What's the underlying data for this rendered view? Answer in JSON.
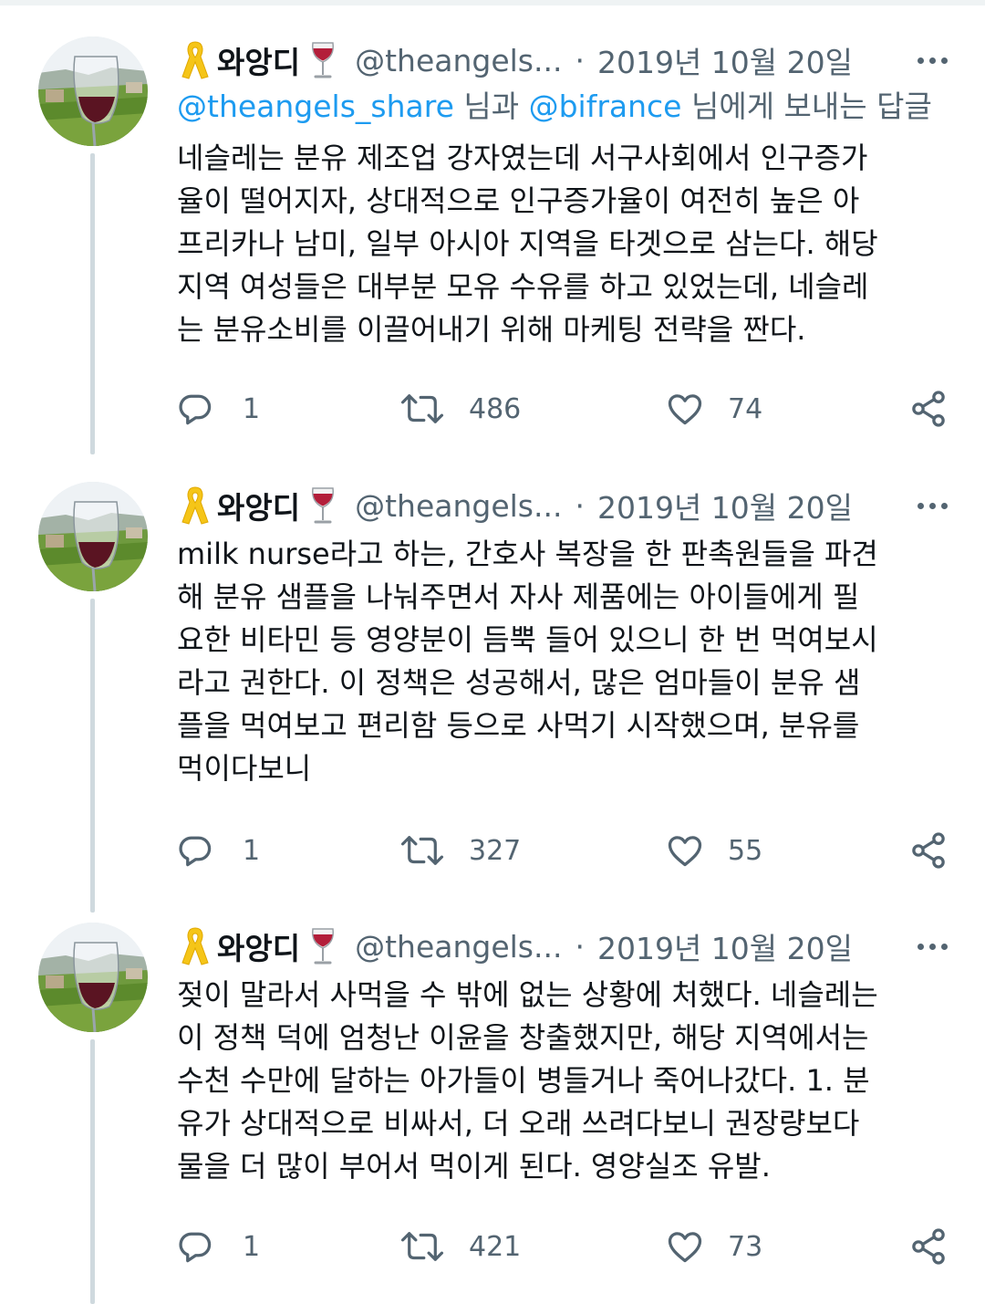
{
  "colors": {
    "text": "#0f1419",
    "secondary": "#536471",
    "link": "#1d9bf0",
    "thread_line": "#cfd9de"
  },
  "author": {
    "display_name": "와앙디",
    "handle": "@theangels...",
    "avatar_icon": "wine-glass-vineyard-avatar",
    "name_icons": [
      "yellow-ribbon-icon",
      "wine-glass-icon"
    ]
  },
  "tweets": [
    {
      "date": "2019년 10월 20일",
      "reply_to": {
        "mention1": "@theangels_share",
        "mid": " 님과 ",
        "mention2": "@bifrance",
        "end": " 님에게 보내는 답글"
      },
      "lines": [
        "네슬레는 분유 제조업 강자였는데 서구사회에서 인구증가",
        "율이 떨어지자, 상대적으로 인구증가율이 여전히 높은 아",
        "프리카나 남미, 일부 아시아 지역을 타겟으로 삼는다. 해당",
        "지역 여성들은 대부분 모유 수유를 하고 있었는데, 네슬레",
        "는 분유소비를 이끌어내기 위해 마케팅 전략을 짠다."
      ],
      "replies": "1",
      "retweets": "486",
      "likes": "74"
    },
    {
      "date": "2019년 10월 20일",
      "lines": [
        "milk nurse라고 하는, 간호사 복장을 한 판촉원들을 파견",
        "해 분유 샘플을 나눠주면서 자사 제품에는 아이들에게 필",
        "요한 비타민 등 영양분이 듬뿍 들어 있으니 한 번 먹여보시",
        "라고 권한다. 이 정책은 성공해서, 많은 엄마들이 분유 샘",
        "플을 먹여보고 편리함 등으로 사먹기 시작했으며, 분유를",
        "먹이다보니"
      ],
      "replies": "1",
      "retweets": "327",
      "likes": "55"
    },
    {
      "date": "2019년 10월 20일",
      "lines": [
        "젖이 말라서 사먹을 수 밖에 없는 상황에 처했다. 네슬레는",
        "이 정책 덕에 엄청난 이윤을 창출했지만, 해당 지역에서는",
        "수천 수만에 달하는 아가들이 병들거나 죽어나갔다. 1. 분",
        "유가 상대적으로 비싸서, 더 오래 쓰려다보니 권장량보다",
        "물을 더 많이 부어서 먹이게 된다. 영양실조 유발."
      ],
      "replies": "1",
      "retweets": "421",
      "likes": "73"
    }
  ]
}
